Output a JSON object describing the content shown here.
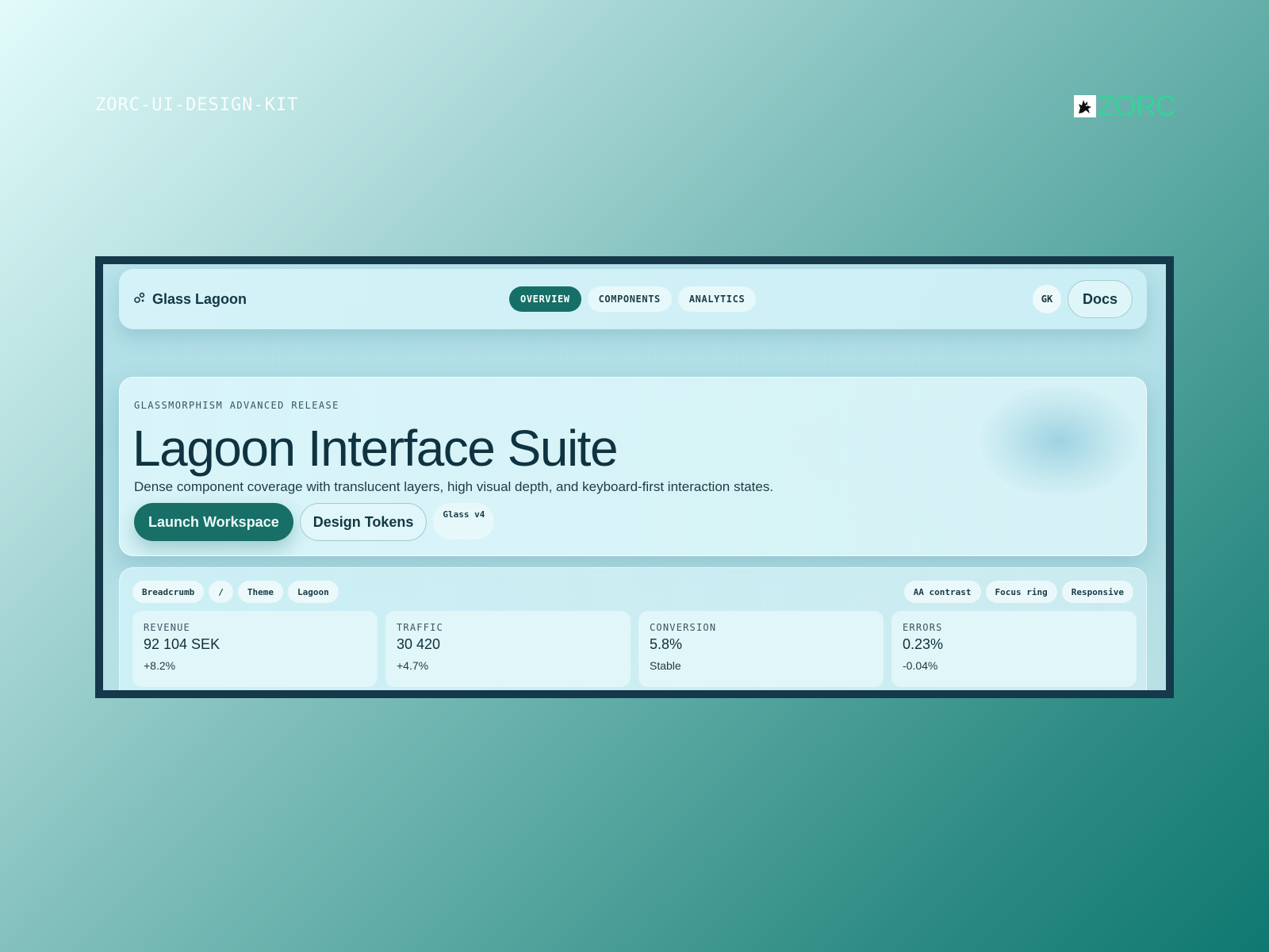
{
  "kit_title": "ZORC-UI-DESIGN-KIT",
  "brand": {
    "name": "ZORC",
    "color": "#34d399",
    "icon": "wolf-icon"
  },
  "app": {
    "name": "Glass Lagoon",
    "logo_icon": "nodes-icon",
    "nav": [
      {
        "label": "OVERVIEW",
        "active": true
      },
      {
        "label": "COMPONENTS",
        "active": false
      },
      {
        "label": "ANALYTICS",
        "active": false
      }
    ],
    "avatar_initials": "GK",
    "docs_label": "Docs"
  },
  "hero": {
    "eyebrow": "GLASSMORPHISM ADVANCED RELEASE",
    "title": "Lagoon Interface Suite",
    "subtitle": "Dense component coverage with translucent layers, high visual depth, and keyboard-first interaction states.",
    "primary_label": "Launch Workspace",
    "secondary_label": "Design Tokens",
    "tag": "Glass v4"
  },
  "breadcrumb": [
    "Breadcrumb",
    "/",
    "Theme",
    "Lagoon"
  ],
  "flags": [
    "AA contrast",
    "Focus ring",
    "Responsive"
  ],
  "stats": [
    {
      "label": "REVENUE",
      "value": "92 104 SEK",
      "delta": "+8.2%"
    },
    {
      "label": "TRAFFIC",
      "value": "30 420",
      "delta": "+4.7%"
    },
    {
      "label": "CONVERSION",
      "value": "5.8%",
      "delta": "Stable"
    },
    {
      "label": "ERRORS",
      "value": "0.23%",
      "delta": "-0.04%"
    }
  ],
  "colors": {
    "accent": "#176f67",
    "frame": "#15384a",
    "ink": "#0f3340"
  }
}
